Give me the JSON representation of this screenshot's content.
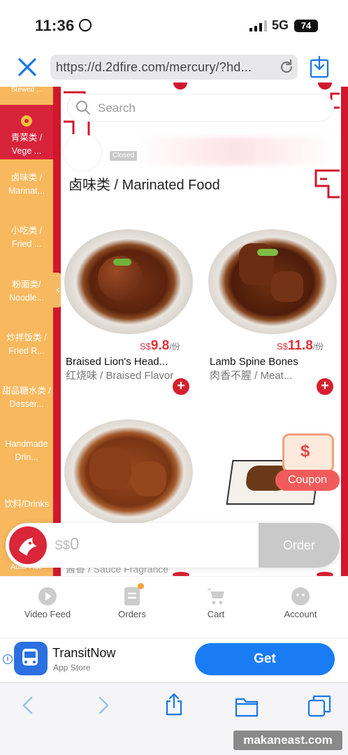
{
  "status_bar": {
    "time": "11:36",
    "network": "5G",
    "battery": "74"
  },
  "browser": {
    "url": "https://d.2dfire.com/mercury/?hd..."
  },
  "sidebar": {
    "top_partial": "Stewed ...",
    "items": [
      {
        "label": "青菜类 / Vege ..."
      },
      {
        "label": "卤味类 / Marinat..."
      },
      {
        "label": "小吃类 / Fried ..."
      },
      {
        "label": "粉面类/ Noodle..."
      },
      {
        "label": "炒拌饭类 / Fried R..."
      },
      {
        "label": "甜品糖水类 / Desser..."
      },
      {
        "label": "Handmade Drin..."
      },
      {
        "label": "饮料/Drinks"
      },
      {
        "label": "Auto-Ade"
      }
    ]
  },
  "search": {
    "placeholder": "Search"
  },
  "shop": {
    "status": "Closed"
  },
  "section": {
    "title": "卤味类 / Marinated Food"
  },
  "dishes": [
    {
      "name": "Braised Lion's Head...",
      "sub": "红烧味 / Braised Flavor",
      "currency": "S$",
      "price": "9.8",
      "unit": "/份"
    },
    {
      "name": "Lamb Spine Bones",
      "sub": "肉香不腥 / Meat...",
      "currency": "S$",
      "price": "11.8",
      "unit": "/份"
    }
  ],
  "partial_row_text": "酱香 / Sauce Fragrance",
  "coupon": {
    "label": "Coupon",
    "symbol": "$"
  },
  "cart": {
    "currency": "S$",
    "total": "0",
    "order_label": "Order"
  },
  "app_nav": [
    {
      "label": "Video Feed",
      "icon": "play-icon"
    },
    {
      "label": "Orders",
      "icon": "orders-icon"
    },
    {
      "label": "Cart",
      "icon": "cart-icon"
    },
    {
      "label": "Account",
      "icon": "account-icon"
    }
  ],
  "ad": {
    "title": "TransitNow",
    "subtitle": "App Store",
    "button": "Get"
  },
  "watermark": "makaneast.com",
  "colors": {
    "accent_red": "#d6202f",
    "sidebar_orange": "#f8b85e",
    "get_blue": "#1a7cf5"
  }
}
